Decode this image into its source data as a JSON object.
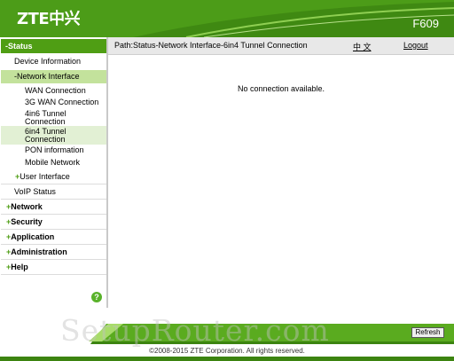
{
  "header": {
    "logo": "ZTE中兴",
    "model": "F609"
  },
  "sidebar": {
    "status": "-Status",
    "device_information": "Device Information",
    "network_interface": "-Network Interface",
    "wan_connection": "WAN Connection",
    "wan_3g": "3G WAN Connection",
    "tunnel_4in6": "4in6 Tunnel Connection",
    "tunnel_6in4": "6in4 Tunnel Connection",
    "pon_information": "PON information",
    "mobile_network": "Mobile Network",
    "user_interface": "User Interface",
    "voip_status": "VoIP Status",
    "network": "Network",
    "security": "Security",
    "application": "Application",
    "administration": "Administration",
    "help": "Help",
    "plus": "+",
    "help_icon": "?"
  },
  "content": {
    "path": "Path:Status-Network Interface-6in4 Tunnel Connection",
    "language": "中 文",
    "logout": "Logout",
    "message": "No connection available."
  },
  "footer": {
    "refresh": "Refresh",
    "copyright": "©2008-2015 ZTE Corporation. All rights reserved."
  },
  "watermark": "SetupRouter.com",
  "colors": {
    "brand_green": "#4f9e14",
    "selected_bg": "#e2f0d4"
  }
}
